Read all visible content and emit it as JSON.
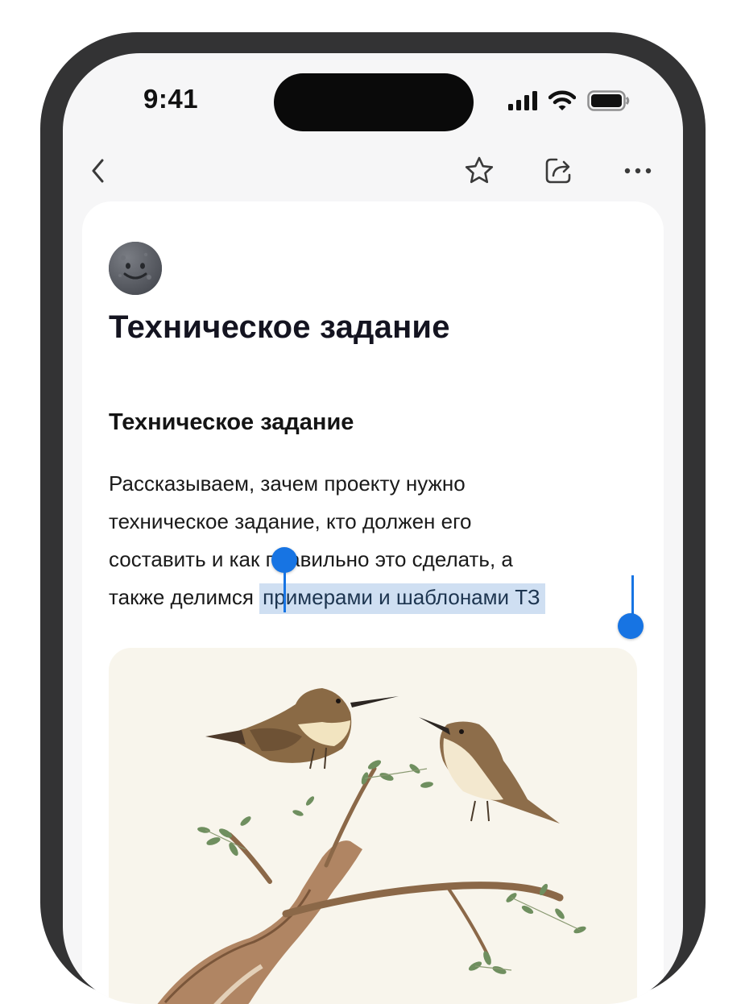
{
  "status_bar": {
    "time": "9:41",
    "icons": [
      "signal-icon",
      "wifi-icon",
      "battery-icon"
    ]
  },
  "toolbar": {
    "icons": [
      "back-chevron-icon",
      "star-icon",
      "share-icon",
      "more-icon"
    ]
  },
  "document": {
    "avatar_icon": "moon-face-icon",
    "title": "Техническое задание",
    "section_heading": "Техническое задание",
    "paragraph_lines": [
      "Рассказываем, зачем проекту нужно",
      "техническое задание, кто должен его",
      "составить и как правильно это сделать, а",
      "также делимся "
    ],
    "selected_text": "примерами и шаблонами ТЗ"
  },
  "colors": {
    "accent": "#1774e3",
    "selection": "#cfdff2",
    "frame": "#333334",
    "screen_bg": "#f6f6f7",
    "card_bg": "#ffffff"
  }
}
